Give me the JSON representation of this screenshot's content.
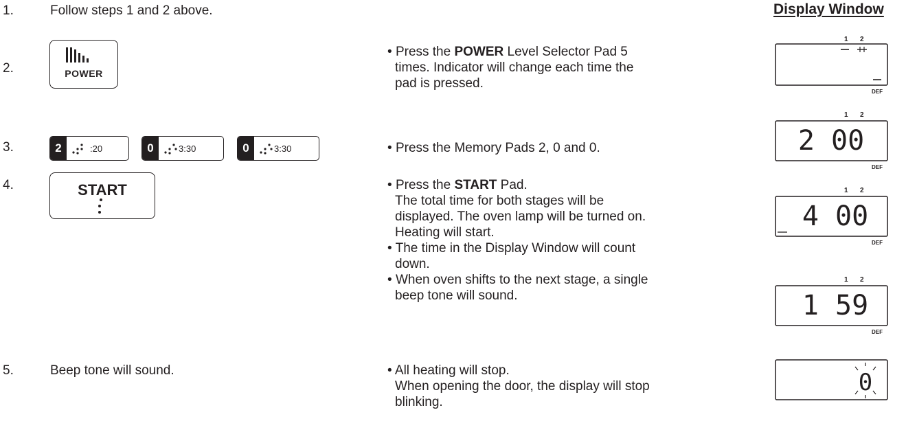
{
  "display_window_title": "Display Window",
  "steps": [
    {
      "number": "1.",
      "left_text": "Follow steps 1 and 2 above."
    },
    {
      "number": "2.",
      "pad_label": "POWER",
      "instr": {
        "pre": "Press the ",
        "bold": "POWER",
        "post": " Level Selector Pad 5",
        "line2": "times. Indicator will change each time the",
        "line3": "pad is pressed."
      }
    },
    {
      "number": "3.",
      "pads": [
        {
          "digit": "2",
          "symbol": ":20"
        },
        {
          "digit": "0",
          "symbol": "3:30"
        },
        {
          "digit": "0",
          "symbol": "3:30"
        }
      ],
      "instr": "Press the Memory Pads 2, 0 and 0."
    },
    {
      "number": "4.",
      "pad_label": "START",
      "instr": {
        "pre": "Press the ",
        "bold": "START",
        "post": " Pad.",
        "lines": [
          "The total time for both stages will be",
          "displayed. The oven lamp will be turned on.",
          "Heating will start."
        ]
      },
      "instr2": [
        "The time in the Display Window will count",
        "down."
      ],
      "instr3": [
        "When oven shifts to the next stage, a single",
        "beep tone will sound."
      ]
    },
    {
      "number": "5.",
      "left_text": "Beep tone will sound.",
      "instr": [
        "All heating will stop.",
        "When opening the door, the display will stop",
        "blinking."
      ]
    }
  ],
  "displays": [
    {
      "stage_labels": [
        "1",
        "2"
      ],
      "digits": "",
      "footer": "DEF"
    },
    {
      "stage_labels": [
        "1",
        "2"
      ],
      "digits": "2 00",
      "footer": "DEF"
    },
    {
      "stage_labels": [
        "1",
        "2"
      ],
      "digits": "4 00",
      "footer": "DEF"
    },
    {
      "stage_labels": [
        "1",
        "2"
      ],
      "digits": "1 59",
      "footer": "DEF"
    },
    {
      "digits": "0"
    }
  ]
}
